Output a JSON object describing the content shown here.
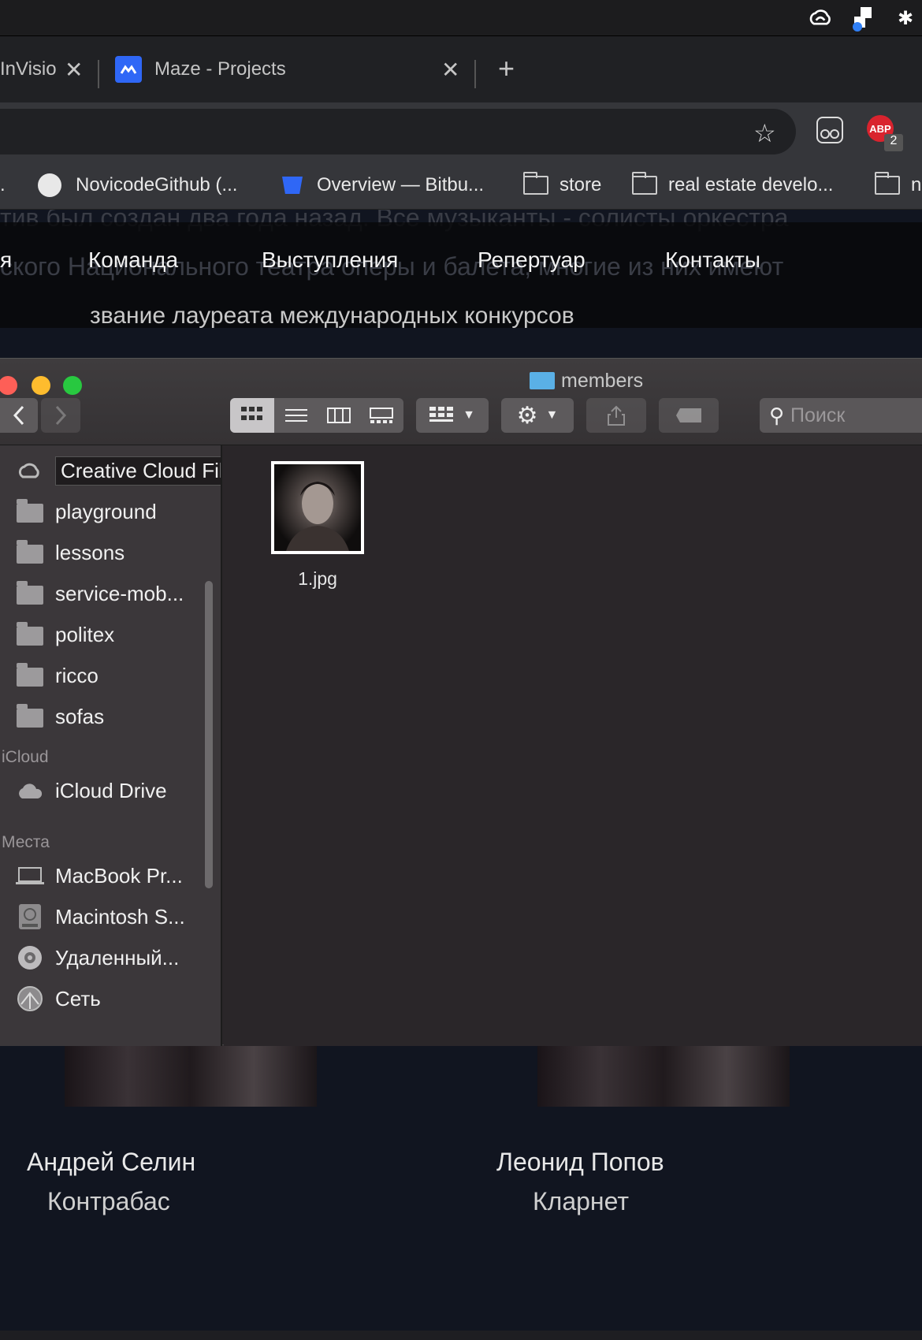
{
  "browser": {
    "tabs": [
      {
        "label": "InVisio"
      },
      {
        "label": "Maze - Projects"
      }
    ],
    "new_tab_symbol": "+",
    "close_symbol": "✕",
    "bookmarks": [
      {
        "label": "NovicodeGithub (..."
      },
      {
        "label": "Overview — Bitbu..."
      },
      {
        "label": "store"
      },
      {
        "label": "real estate develo..."
      },
      {
        "label": "n"
      }
    ],
    "abp": {
      "label": "ABP",
      "badge": "2"
    }
  },
  "website": {
    "ghost_lines": [
      "тив был создан два года назад. Все музыканты - солисты оркестра",
      "ского Национального театра оперы и балета, многие из них имеют",
      "звание лауреата международных конкурсов"
    ],
    "nav": {
      "partial": "я",
      "items": [
        "Команда",
        "Выступления",
        "Репертуар",
        "Контакты"
      ]
    },
    "members": [
      {
        "name": "Андрей Селин",
        "role": "Контрабас"
      },
      {
        "name": "Леонид Попов",
        "role": "Кларнет"
      }
    ]
  },
  "finder": {
    "title": "members",
    "search_placeholder": "Поиск",
    "sidebar": {
      "favorites": [
        {
          "label": "Creative Cloud Files",
          "icon": "creative-cloud-icon"
        },
        {
          "label": "playground",
          "icon": "folder-icon"
        },
        {
          "label": "lessons",
          "icon": "folder-icon"
        },
        {
          "label": "service-mob...",
          "icon": "folder-icon"
        },
        {
          "label": "politex",
          "icon": "folder-icon"
        },
        {
          "label": "ricco",
          "icon": "folder-icon"
        },
        {
          "label": "sofas",
          "icon": "folder-icon"
        }
      ],
      "icloud_header": "iCloud",
      "icloud": [
        {
          "label": "iCloud Drive",
          "icon": "cloud-icon"
        }
      ],
      "places_header": "Места",
      "places": [
        {
          "label": "MacBook Pr...",
          "icon": "laptop-icon"
        },
        {
          "label": "Macintosh S...",
          "icon": "disk-icon"
        },
        {
          "label": "Удаленный...",
          "icon": "optical-disc-icon"
        },
        {
          "label": "Сеть",
          "icon": "network-icon"
        }
      ]
    },
    "files": [
      {
        "name": "1.jpg"
      }
    ]
  },
  "colors": {
    "close": "#fe5f57",
    "minimize": "#febc2e",
    "zoom": "#28c840",
    "folder_blue": "#5ab0e6",
    "abp_red": "#d9232e"
  }
}
